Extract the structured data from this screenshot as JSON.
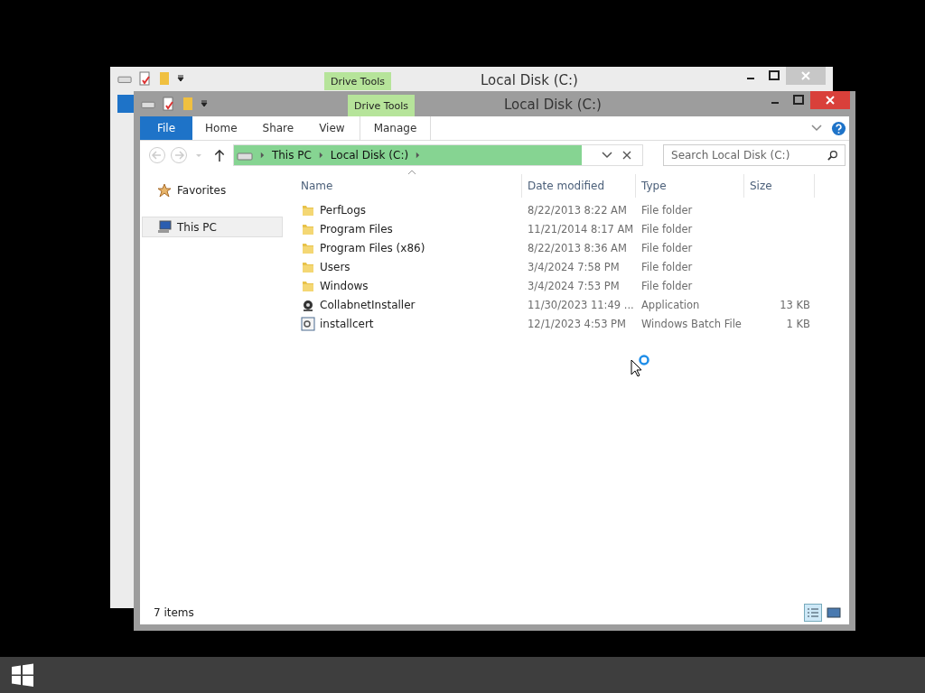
{
  "back_window": {
    "title": "Local Disk (C:)",
    "context_tab": "Drive Tools"
  },
  "window": {
    "title": "Local Disk (C:)",
    "context_tab": "Drive Tools"
  },
  "ribbon_tabs": [
    {
      "label": "File",
      "kind": "file"
    },
    {
      "label": "Home",
      "kind": "plain"
    },
    {
      "label": "Share",
      "kind": "plain"
    },
    {
      "label": "View",
      "kind": "plain"
    },
    {
      "label": "Manage",
      "kind": "context"
    }
  ],
  "address": {
    "crumbs": [
      "This PC",
      "Local Disk (C:)"
    ]
  },
  "search": {
    "placeholder": "Search Local Disk (C:)"
  },
  "nav": [
    {
      "label": "Favorites",
      "kind": "favorites",
      "selected": false
    },
    {
      "label": "This PC",
      "kind": "pc",
      "selected": true
    }
  ],
  "columns": [
    "Name",
    "Date modified",
    "Type",
    "Size"
  ],
  "files": [
    {
      "name": "PerfLogs",
      "date": "8/22/2013 8:22 AM",
      "type": "File folder",
      "kind": "folder"
    },
    {
      "name": "Program Files",
      "date": "11/21/2014 8:17 AM",
      "type": "File folder",
      "kind": "folder"
    },
    {
      "name": "Program Files (x86)",
      "date": "8/22/2013 8:36 AM",
      "type": "File folder",
      "kind": "folder"
    },
    {
      "name": "Users",
      "date": "3/4/2024 7:58 PM",
      "type": "File folder",
      "kind": "folder"
    },
    {
      "name": "Windows",
      "date": "3/4/2024 7:53 PM",
      "type": "File folder",
      "kind": "folder"
    },
    {
      "name": "CollabnetInstaller",
      "date": "11/30/2023 11:49 ...",
      "type": "Application",
      "size": "13 KB",
      "kind": "app"
    },
    {
      "name": "installcert",
      "date": "12/1/2023 4:53 PM",
      "type": "Windows Batch File",
      "size": "1 KB",
      "kind": "batch"
    }
  ],
  "status": "7 items",
  "views": [
    {
      "kind": "details",
      "selected": true
    },
    {
      "kind": "tiles",
      "selected": false
    }
  ]
}
